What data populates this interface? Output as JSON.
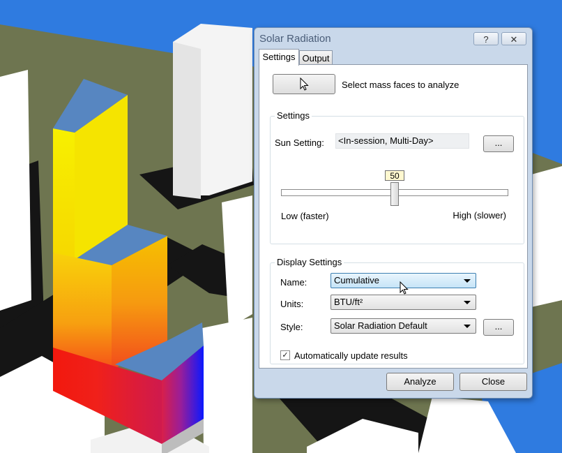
{
  "window": {
    "title": "Solar Radiation",
    "help_glyph": "?",
    "close_glyph": "✕"
  },
  "tabs": [
    {
      "label": "Settings"
    },
    {
      "label": "Output"
    }
  ],
  "select": {
    "label": "Select mass faces to analyze"
  },
  "settings": {
    "title": "Settings",
    "sun_setting_label": "Sun Setting:",
    "sun_setting_value": "<In-session, Multi-Day>",
    "browse_label": "...",
    "slider_value": "50",
    "slider_level": 0.5,
    "low_label": "Low (faster)",
    "high_label": "High (slower)"
  },
  "display": {
    "title": "Display Settings",
    "name_label": "Name:",
    "name_value": "Cumulative",
    "units_label": "Units:",
    "units_value": "BTU/ft²",
    "style_label": "Style:",
    "style_value": "Solar Radiation Default",
    "style_browse": "...",
    "auto_update_label": "Automatically update results",
    "auto_update_checked": true,
    "check_glyph": "✓"
  },
  "footer": {
    "analyze_label": "Analyze",
    "close_label": "Close"
  },
  "colors": {
    "ground": "#6e7550",
    "water": "#2f7be0",
    "roof": "#5786c1",
    "accent": "#3c7fb1"
  }
}
